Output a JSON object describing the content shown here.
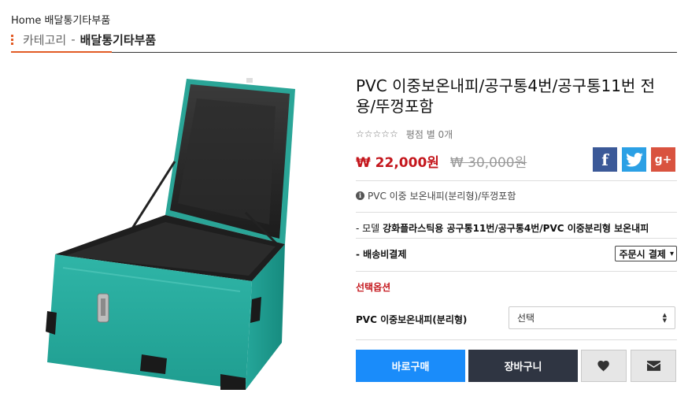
{
  "breadcrumb": "Home 배달통기타부품",
  "category": {
    "label": "카테고리",
    "separator": "-",
    "current": "배달통기타부품",
    "accent_color": "#e25b25"
  },
  "product": {
    "title": "PVC 이중보온내피/공구통4번/공구통11번 전용/뚜껑포함",
    "rating_stars": "☆☆☆☆☆",
    "rating_text": "평점 별 0개",
    "price": "₩ 22,000원",
    "old_price": "₩ 30,000원",
    "summary": "PVC 이중 보온내피(분리형)/뚜껑포함",
    "price_color": "#c4161c"
  },
  "social": {
    "facebook": "f",
    "twitter_icon": "twitter-bird",
    "googleplus": "g+"
  },
  "details": {
    "model_label": "- 모델",
    "model_value": "강화플라스틱용 공구통11번/공구통4번/PVC 이중분리형 보온내피",
    "shipping_label": "- 배송비결제",
    "shipping_select": "주문시 결제"
  },
  "options": {
    "header": "선택옵션",
    "label": "PVC 이중보온내피(분리형)",
    "select_value": "선택"
  },
  "buttons": {
    "buy": "바로구매",
    "cart": "장바구니",
    "wish_icon": "heart-icon",
    "mail_icon": "envelope-icon"
  }
}
